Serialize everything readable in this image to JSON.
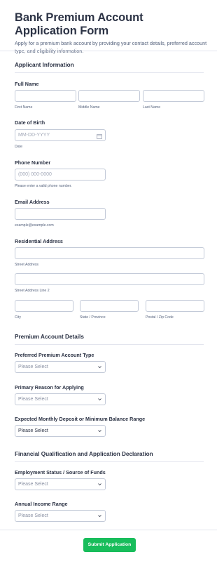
{
  "form": {
    "title": "Bank Premium Account Application Form",
    "description": "Apply for a premium bank account by providing your contact details, preferred account type, and eligibility information."
  },
  "applicant": {
    "section_title": "Applicant Information",
    "full_name": {
      "label": "Full Name",
      "first": "First Name",
      "middle": "Middle Name",
      "last": "Last Name"
    },
    "dob": {
      "label": "Date of Birth",
      "placeholder": "MM-DD-YYYY",
      "sublabel": "Date"
    },
    "phone": {
      "label": "Phone Number",
      "placeholder": "(000) 000-0000",
      "sublabel": "Please enter a valid phone number."
    },
    "email": {
      "label": "Email Address",
      "sublabel": "example@example.com"
    },
    "address": {
      "label": "Residential Address",
      "street": "Street Address",
      "street2": "Street Address Line 2",
      "city": "City",
      "state": "State / Province",
      "zip": "Postal / Zip Code"
    }
  },
  "premium": {
    "section_title": "Premium Account Details",
    "account_type": {
      "label": "Preferred Premium Account Type",
      "value": "Please Select"
    },
    "reason": {
      "label": "Primary Reason for Applying",
      "value": "Please Select"
    },
    "deposit": {
      "label": "Expected Monthly Deposit or Minimum Balance Range",
      "value": "Please Select"
    }
  },
  "financial": {
    "section_title": "Financial Qualification and Application Declaration",
    "employment": {
      "label": "Employment Status / Source of Funds",
      "value": "Please Select"
    },
    "income": {
      "label": "Annual Income Range",
      "value": "Please Select"
    }
  },
  "submit": {
    "label": "Submit Application",
    "color": "#18bd5b"
  }
}
